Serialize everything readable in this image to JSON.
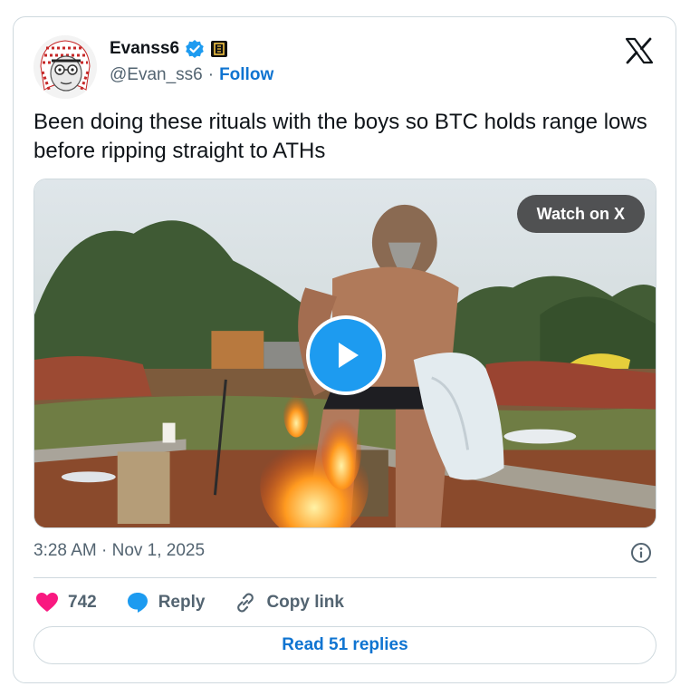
{
  "author": {
    "name": "Evanss6",
    "handle": "@Evan_ss6",
    "separator": "·",
    "follow_label": "Follow"
  },
  "tweet": {
    "text": "Been doing these rituals with the boys so BTC holds range lows before ripping straight to ATHs"
  },
  "media": {
    "watch_label": "Watch on X"
  },
  "meta": {
    "timestamp": "3:28 AM · Nov 1, 2025"
  },
  "actions": {
    "like_count": "742",
    "reply_label": "Reply",
    "copy_label": "Copy link"
  },
  "footer": {
    "read_replies_label": "Read 51 replies"
  },
  "colors": {
    "accent_blue": "#1d9bf0",
    "link_blue": "#0f74d1",
    "like_pink": "#f91880",
    "muted_text": "#536471",
    "border": "#cfd9de"
  },
  "icons": [
    "avatar-illustration",
    "verified-badge-icon",
    "square-badge-icon",
    "x-logo-icon",
    "play-icon",
    "info-icon",
    "heart-icon",
    "reply-bubble-icon",
    "link-icon"
  ]
}
